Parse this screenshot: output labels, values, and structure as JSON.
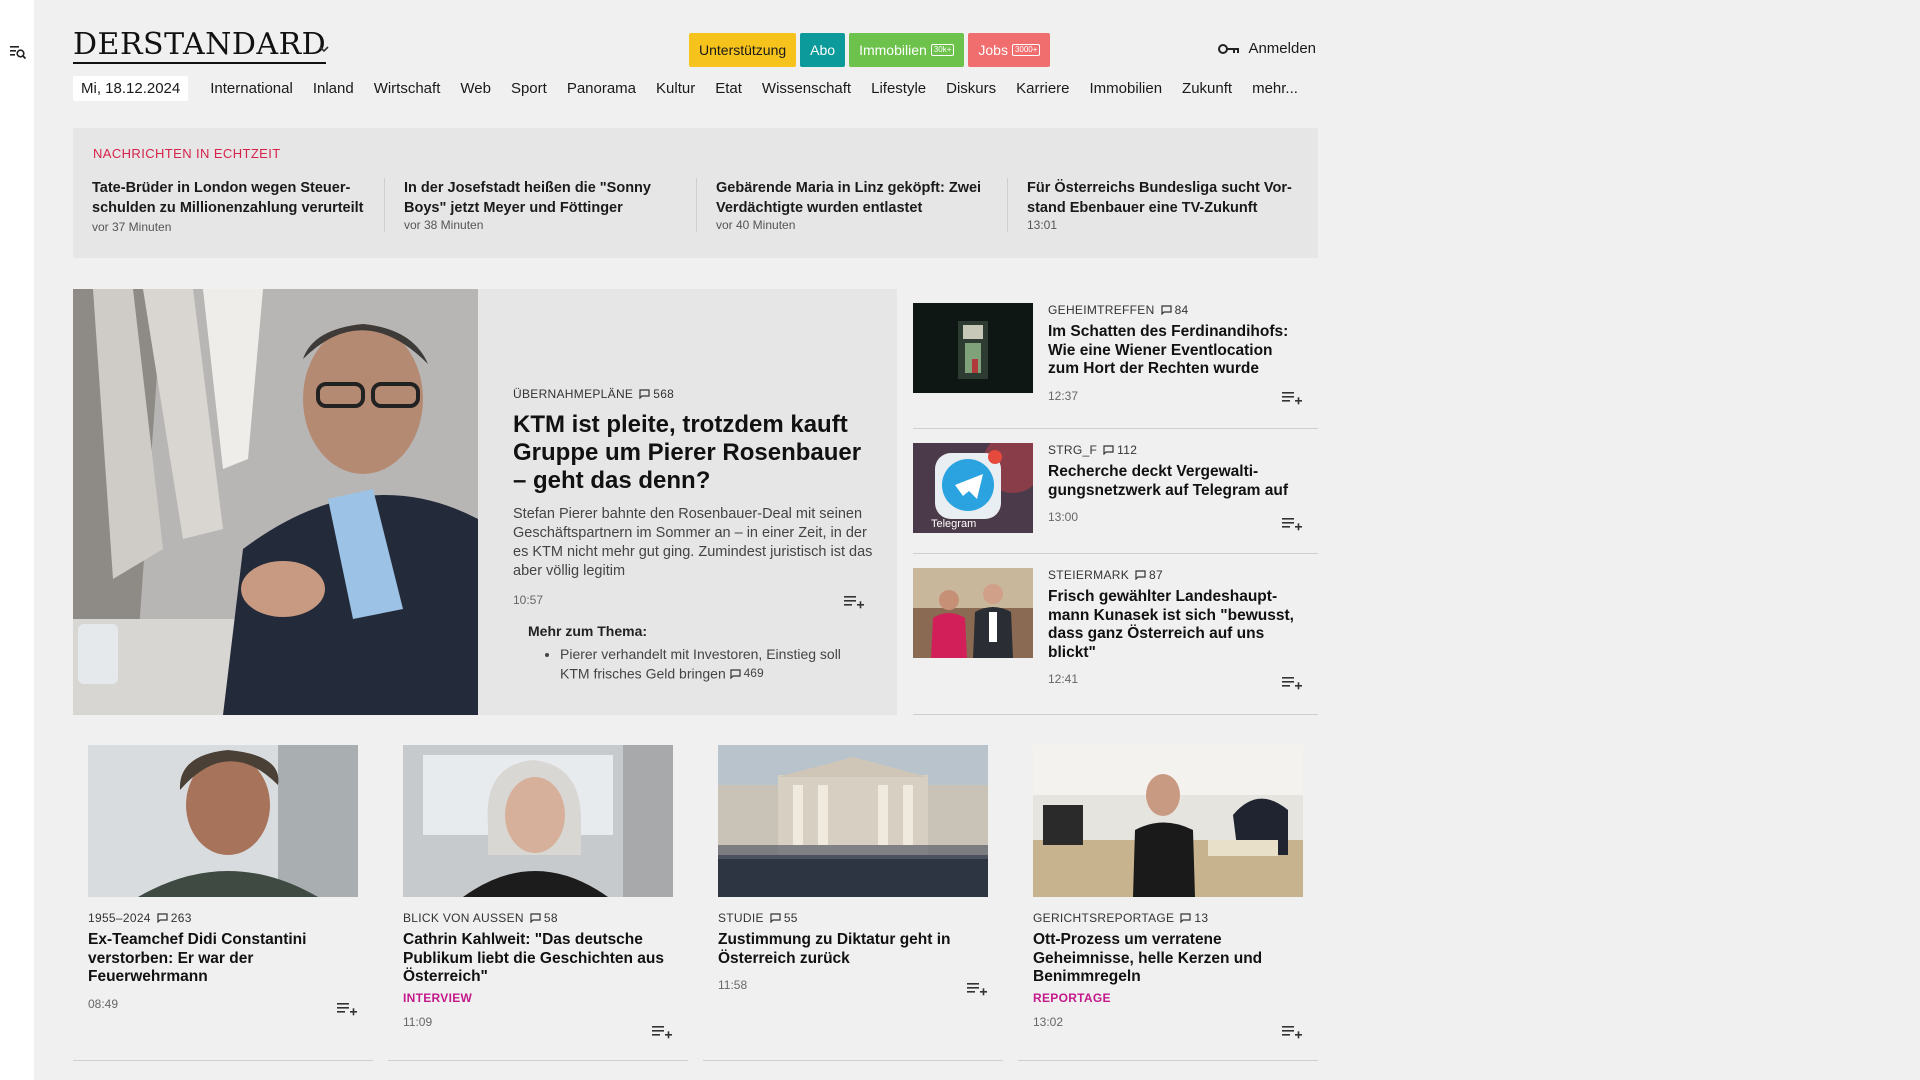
{
  "header": {
    "logo": "DERSTANDARD",
    "pills": [
      {
        "label": "Unterstützung",
        "badge": "",
        "bg": "#f6c31c",
        "fg": "#1a1a1a"
      },
      {
        "label": "Abo",
        "badge": "",
        "bg": "#0c9a9a",
        "fg": "#ffffff"
      },
      {
        "label": "Immobilien",
        "badge": "30k+",
        "bg": "#6cc24a",
        "fg": "#ffffff"
      },
      {
        "label": "Jobs",
        "badge": "3000+",
        "bg": "#f06e6e",
        "fg": "#ffffff"
      }
    ],
    "login_label": "Anmelden"
  },
  "nav": {
    "date": "Mi, 18.12.2024",
    "items": [
      "International",
      "Inland",
      "Wirtschaft",
      "Web",
      "Sport",
      "Panorama",
      "Kultur",
      "Etat",
      "Wissenschaft",
      "Lifestyle",
      "Diskurs",
      "Karriere",
      "Immobilien",
      "Zukunft",
      "mehr..."
    ]
  },
  "ticker": {
    "title": "NACHRICHTEN IN ECHTZEIT",
    "items": [
      {
        "headline": "Tate-Brüder in London wegen Steuer­schulden zu Millionenzahlung verur­teilt",
        "time": "vor 37 Minuten"
      },
      {
        "headline": "In der Josefstadt heißen die \"Sonny Boys\" jetzt Meyer und Föttinger",
        "time": "vor 38 Minuten"
      },
      {
        "headline": "Gebärende Maria in Linz geköpft: Zwei Verdächtigte wurden entlastet",
        "time": "vor 40 Minuten"
      },
      {
        "headline": "Für Österreichs Bundesliga sucht Vor­stand Ebenbauer eine TV-Zukunft",
        "time": "13:01"
      }
    ]
  },
  "lead": {
    "kicker": "ÜBERNAHMEPLÄNE",
    "comments": "568",
    "title": "KTM ist pleite, trotzdem kauft Gruppe um Pierer Rosenbauer – geht das denn?",
    "subtitle": "Stefan Pierer bahnte den Rosenbauer-Deal mit seinen Geschäftspartnern im Sommer an – in einer Zeit, in der es KTM nicht mehr gut ging. Zumindest juristisch ist das aber völlig legitim",
    "time": "10:57",
    "more_title": "Mehr zum Thema:",
    "more_items": [
      {
        "text": "Pierer verhandelt mit Investoren, Einstieg soll KTM frisches Geld bringen",
        "comments": "469"
      }
    ]
  },
  "side": [
    {
      "kicker": "GEHEIMTREFFEN",
      "comments": "84",
      "title": "Im Schatten des Ferdinandihofs: Wie eine Wiener Eventlocation zum Hort der Rechten wurde",
      "time": "12:37"
    },
    {
      "kicker": "STRG_F",
      "comments": "112",
      "title": "Recherche deckt Vergewalti­gungsnetzwerk auf Telegram auf",
      "time": "13:00",
      "img_label": "Telegram"
    },
    {
      "kicker": "STEIERMARK",
      "comments": "87",
      "title": "Frisch gewählter Landeshaupt­mann Kunasek ist sich \"bewusst, dass ganz Österreich auf uns blickt\"",
      "time": "12:41"
    }
  ],
  "cards": [
    {
      "kicker": "1955–2024",
      "comments": "263",
      "title": "Ex-Teamchef Didi Constantini verstorben: Er war der Feuerwehrmann",
      "label": "",
      "time": "08:49"
    },
    {
      "kicker": "BLICK VON AUSSEN",
      "comments": "58",
      "title": "Cathrin Kahlweit: \"Das deutsche Publikum liebt die Geschichten aus Österreich\"",
      "label": "INTERVIEW",
      "time": "11:09"
    },
    {
      "kicker": "STUDIE",
      "comments": "55",
      "title": "Zustimmung zu Diktatur geht in Österreich zurück",
      "label": "",
      "time": "11:58"
    },
    {
      "kicker": "GERICHTSREPORTAGE",
      "comments": "13",
      "title": "Ott-Prozess um verratene Geheimnisse, helle Kerzen und Benimmregeln",
      "label": "REPORTAGE",
      "time": "13:02"
    }
  ]
}
